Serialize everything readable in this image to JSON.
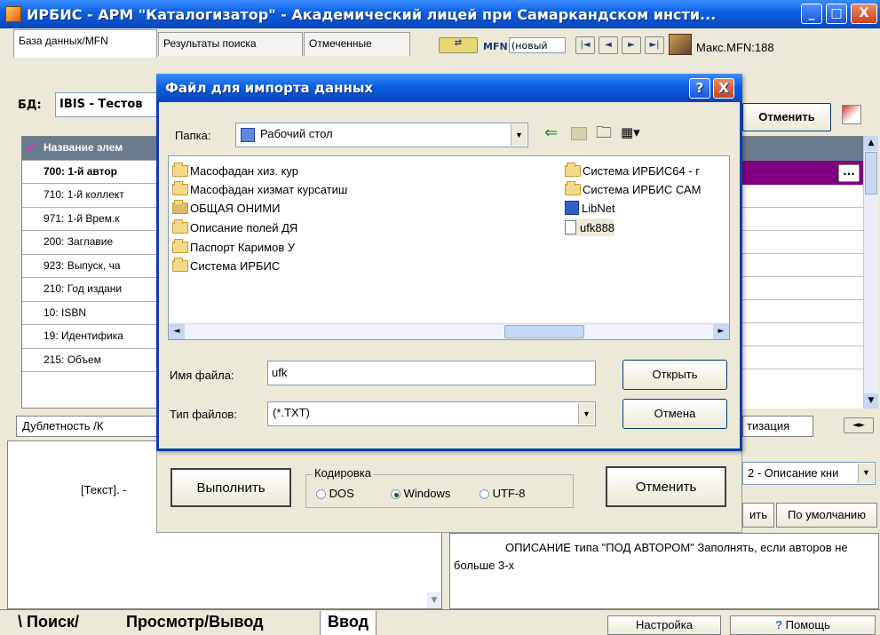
{
  "window": {
    "title": "ИРБИС - АРМ \"Каталогизатор\" - Академический лицей при Самаркандском инсти...",
    "minimize": "_",
    "maximize": "□",
    "close": "X"
  },
  "toolbar": {
    "tabs": [
      "База данных/MFN",
      "Результаты поиска",
      "Отмеченные"
    ],
    "mfn_label": "MFN",
    "mfn_value": "(новый",
    "nav_first": "|◄",
    "nav_prev": "◄",
    "nav_next": "►",
    "nav_last": "►|",
    "max_mfn": "Макс.MFN:188",
    "db_label": "БД:",
    "db_value": "IBIS - Тестов",
    "cancel_label": "Отменить"
  },
  "fields_table": {
    "header": "Название элем",
    "rows": [
      "700: 1-й автор",
      "710: 1-й коллект",
      "971: 1-й Врем.к",
      "200: Заглавие",
      "923: Выпуск, ча",
      "210: Год издани",
      "10: ISBN",
      "19: Идентифика",
      "215: Объем"
    ],
    "value_button": "..."
  },
  "tabs_row": {
    "left_tabs": [
      "Дублетность",
      "К"
    ],
    "right_tab": "тизация"
  },
  "preview": {
    "text": "[Текст]. -"
  },
  "description": {
    "combo_value": "2 - Описание кни",
    "btn_apply": "ить",
    "btn_default": "По умолчанию",
    "text": "ОПИСАНИЕ типа \"ПОД АВТОРОМ\"     Заполнять, если авторов не больше 3-х"
  },
  "bottom_tabs": {
    "search": "Поиск",
    "view": "Просмотр/Вывод",
    "input": "Ввод",
    "settings": "Настройка",
    "help": "Помощь"
  },
  "import_panel": {
    "execute": "Выполнить",
    "encoding_label": "Кодировка",
    "enc_dos": "DOS",
    "enc_windows": "Windows",
    "enc_utf8": "UTF-8",
    "cancel": "Отменить"
  },
  "dialog": {
    "title": "Файл для импорта данных",
    "help_btn": "?",
    "close_btn": "X",
    "folder_label": "Папка:",
    "folder_value": "Рабочий стол",
    "left_items": [
      "Масофадан хиз. кур",
      "Масофадан хизмат курсатиш",
      "ОБЩАЯ ОНИМИ",
      "Описание полей ДЯ",
      "Паспорт Каримов У",
      "Система ИРБИС"
    ],
    "right_items": [
      "Система ИРБИС64 - г",
      "Система ИРБИС САМ",
      "LibNet",
      "ufk888"
    ],
    "filename_label": "Имя файла:",
    "filename_value": "ufk",
    "filetype_label": "Тип файлов:",
    "filetype_value": "(*.TXT)",
    "open_btn": "Открыть",
    "cancel_btn": "Отмена"
  },
  "colors": {
    "titlebar": "#0a5fe0",
    "selected_row": "#800080",
    "table_header": "#6b7b8e"
  }
}
